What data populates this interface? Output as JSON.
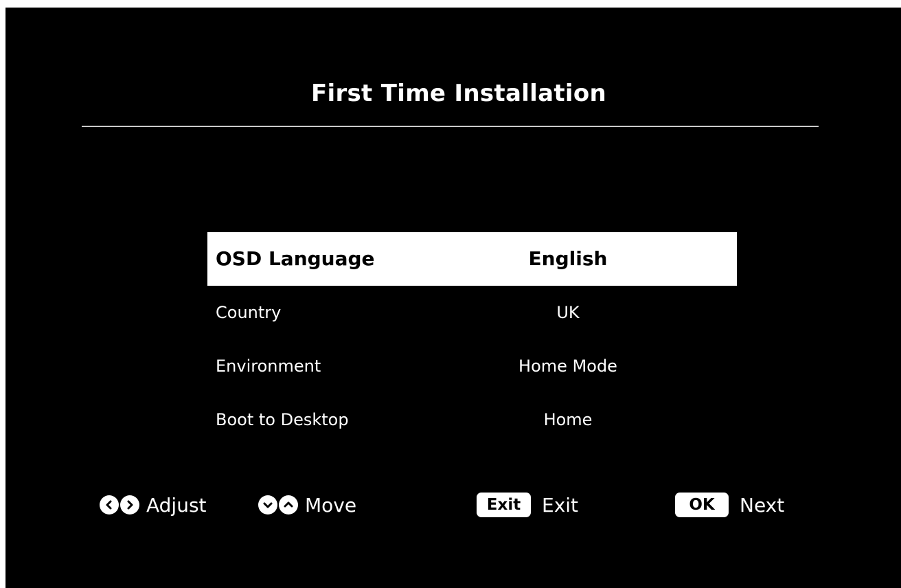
{
  "header": {
    "title": "First Time Installation"
  },
  "settings": [
    {
      "label": "OSD Language",
      "value": "English",
      "selected": true
    },
    {
      "label": "Country",
      "value": "UK",
      "selected": false
    },
    {
      "label": "Environment",
      "value": "Home Mode",
      "selected": false
    },
    {
      "label": "Boot to Desktop",
      "value": "Home",
      "selected": false
    }
  ],
  "hints": {
    "adjust": {
      "label": "Adjust",
      "icons": [
        "arrow-left-icon",
        "arrow-right-icon"
      ]
    },
    "move": {
      "label": "Move",
      "icons": [
        "arrow-down-icon",
        "arrow-up-icon"
      ]
    },
    "exit": {
      "key": "Exit",
      "label": "Exit"
    },
    "next": {
      "key": "OK",
      "label": "Next"
    }
  },
  "colors": {
    "background": "#000000",
    "text": "#ffffff",
    "highlight": "#ffffff",
    "highlight_text": "#000000"
  }
}
